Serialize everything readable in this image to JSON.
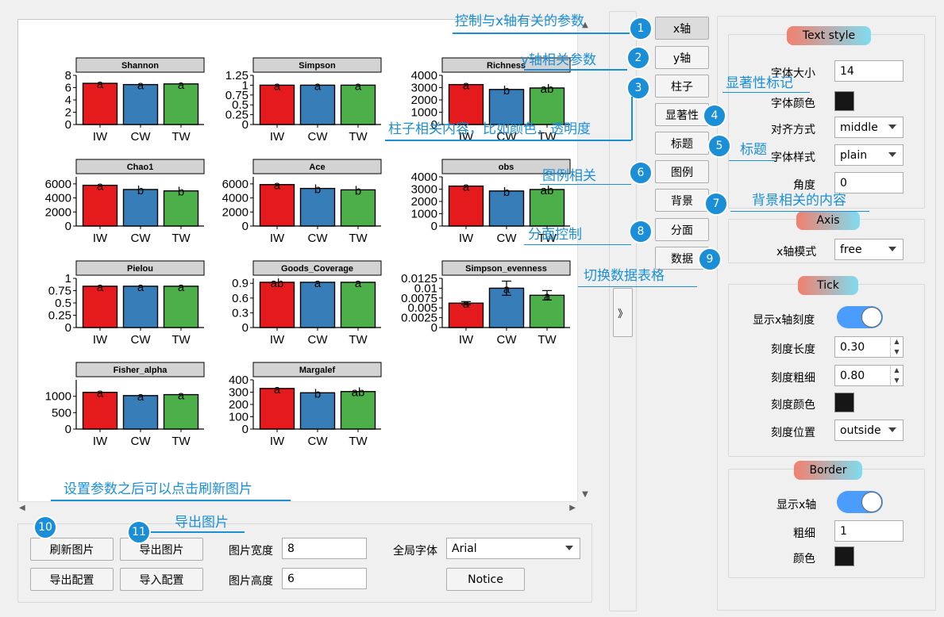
{
  "plot_area": {
    "panels": [
      {
        "title": "Shannon",
        "yticks": [
          "8",
          "6",
          "4",
          "2",
          "0"
        ],
        "values": [
          6.7,
          6.5,
          6.6
        ],
        "ymax": 8,
        "sig": [
          "a",
          "a",
          "a"
        ],
        "err": [
          0,
          0,
          0
        ]
      },
      {
        "title": "Simpson",
        "yticks": [
          "1.25",
          "1",
          "0.75",
          "0.5",
          "0.25",
          "0"
        ],
        "values": [
          1,
          1,
          1
        ],
        "ymax": 1.25,
        "sig": [
          "a",
          "a",
          "a"
        ],
        "err": [
          0,
          0,
          0
        ]
      },
      {
        "title": "Richness",
        "yticks": [
          "4000",
          "3000",
          "2000",
          "1000",
          "0"
        ],
        "values": [
          3250,
          2850,
          2970
        ],
        "ymax": 4000,
        "sig": [
          "a",
          "b",
          "ab"
        ],
        "err": [
          0,
          0,
          0
        ]
      },
      {
        "title": "Chao1",
        "yticks": [
          "6000",
          "4000",
          "2000",
          "0"
        ],
        "values": [
          5800,
          5200,
          5000
        ],
        "ymax": 7000,
        "sig": [
          "a",
          "b",
          "b"
        ],
        "err": [
          0,
          0,
          0
        ]
      },
      {
        "title": "Ace",
        "yticks": [
          "6000",
          "4000",
          "2000",
          "0"
        ],
        "values": [
          5900,
          5350,
          5150
        ],
        "ymax": 7000,
        "sig": [
          "a",
          "b",
          "b"
        ],
        "err": [
          0,
          0,
          0
        ]
      },
      {
        "title": "obs",
        "yticks": [
          "4000",
          "3000",
          "2000",
          "1000",
          "0"
        ],
        "values": [
          3250,
          2850,
          2970
        ],
        "ymax": 4000,
        "sig": [
          "a",
          "b",
          "ab"
        ],
        "err": [
          0,
          0,
          0
        ]
      },
      {
        "title": "Pielou",
        "yticks": [
          "1",
          "0.75",
          "0.5",
          "0.25",
          "0"
        ],
        "values": [
          0.84,
          0.84,
          0.84
        ],
        "ymax": 1.0,
        "sig": [
          "a",
          "a",
          "a"
        ],
        "err": [
          0,
          0,
          0
        ]
      },
      {
        "title": "Goods_Coverage",
        "yticks": [
          "0.9",
          "0.6",
          "0.3",
          "0"
        ],
        "values": [
          0.92,
          0.92,
          0.92
        ],
        "ymax": 1.0,
        "sig": [
          "ab",
          "a",
          "a"
        ],
        "err": [
          0,
          0,
          0
        ]
      },
      {
        "title": "Simpson_evenness",
        "yticks": [
          "0.0125",
          "0.01",
          "0.0075",
          "0.005",
          "0.0025",
          "0"
        ],
        "values": [
          0.0062,
          0.01,
          0.0082
        ],
        "ymax": 0.0125,
        "sig": [
          "a",
          "a",
          "a"
        ],
        "err": [
          0.0004,
          0.0018,
          0.0012
        ]
      },
      {
        "title": "Fisher_alpha",
        "yticks": [
          "1000",
          "500",
          "0"
        ],
        "values": [
          1120,
          1020,
          1050
        ],
        "ymax": 1500,
        "sig": [
          "a",
          "a",
          "a"
        ],
        "err": [
          0,
          0,
          0
        ]
      },
      {
        "title": "Margalef",
        "yticks": [
          "400",
          "300",
          "200",
          "100",
          "0"
        ],
        "values": [
          330,
          295,
          305
        ],
        "ymax": 400,
        "sig": [
          "a",
          "b",
          "ab"
        ],
        "err": [
          0,
          0,
          0
        ]
      }
    ],
    "categories": [
      "IW",
      "CW",
      "TW"
    ],
    "colors": [
      "#e41a1c",
      "#377eb8",
      "#4daf4a"
    ]
  },
  "bottom": {
    "refresh_label": "刷新图片",
    "export_img_label": "导出图片",
    "export_cfg_label": "导出配置",
    "import_cfg_label": "导入配置",
    "width_label": "图片宽度",
    "width_value": "8",
    "height_label": "图片高度",
    "height_value": "6",
    "font_label": "全局字体",
    "font_value": "Arial",
    "notice_label": "Notice"
  },
  "tabs": [
    "x轴",
    "y轴",
    "柱子",
    "显著性",
    "标题",
    "图例",
    "背景",
    "分面",
    "数据"
  ],
  "collapse_label": "》",
  "right": {
    "text_style": {
      "title": "Text style",
      "size_label": "字体大小",
      "size_value": "14",
      "color_label": "字体颜色",
      "align_label": "对齐方式",
      "align_value": "middle",
      "style_label": "字体样式",
      "style_value": "plain",
      "angle_label": "角度",
      "angle_value": "0"
    },
    "axis": {
      "title": "Axis",
      "mode_label": "x轴模式",
      "mode_value": "free"
    },
    "tick": {
      "title": "Tick",
      "show_label": "显示x轴刻度",
      "len_label": "刻度长度",
      "len_value": "0.30",
      "width_label": "刻度粗细",
      "width_value": "0.80",
      "color_label": "刻度颜色",
      "pos_label": "刻度位置",
      "pos_value": "outside"
    },
    "border": {
      "title": "Border",
      "show_label": "显示x轴",
      "width_label": "粗细",
      "width_value": "1",
      "color_label": "颜色"
    }
  },
  "annotations": {
    "a1": "控制与x轴有关的参数",
    "a2": "y轴相关参数",
    "a3": "柱子相关内容，比如颜色，透明度",
    "a4": "显著性标记",
    "a5": "标题",
    "a6": "图例相关",
    "a7": "背景相关的内容",
    "a8": "分面控制",
    "a9": "切换数据表格",
    "a10": "设置参数之后可以点击刷新图片",
    "a11": "导出图片"
  },
  "badges": [
    "1",
    "2",
    "3",
    "4",
    "5",
    "6",
    "7",
    "8",
    "9",
    "10",
    "11"
  ]
}
